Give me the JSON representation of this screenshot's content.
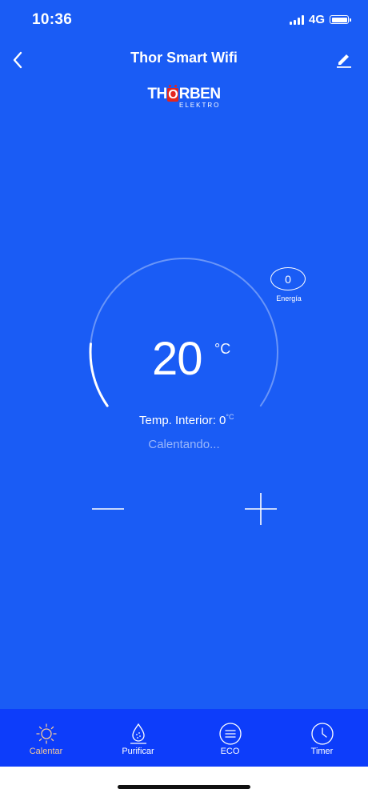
{
  "status_bar": {
    "time": "10:36",
    "network": "4G"
  },
  "header": {
    "title": "Thor Smart Wifi"
  },
  "logo": {
    "brand_prefix": "TH",
    "brand_o": "O",
    "brand_suffix": "RBEN",
    "subtext": "ELEKTRO"
  },
  "energy": {
    "value": "0",
    "label": "Energía"
  },
  "thermostat": {
    "set_temperature": "20",
    "unit": "°C",
    "interior_label": "Temp. Interior: ",
    "interior_value": "0",
    "interior_unit": "°C",
    "status": "Calentando...",
    "dial_progress": 0.16
  },
  "tabs": [
    {
      "label": "Calentar",
      "icon": "sun-icon",
      "active": true
    },
    {
      "label": "Purificar",
      "icon": "drop-icon",
      "active": false
    },
    {
      "label": "ECO",
      "icon": "eco-lines-icon",
      "active": false
    },
    {
      "label": "Timer",
      "icon": "clock-icon",
      "active": false
    }
  ],
  "colors": {
    "background": "#1a5cf5",
    "tabbar": "#0d3dfa",
    "active_tab": "#f3c89a",
    "logo_red": "#e3261f"
  }
}
